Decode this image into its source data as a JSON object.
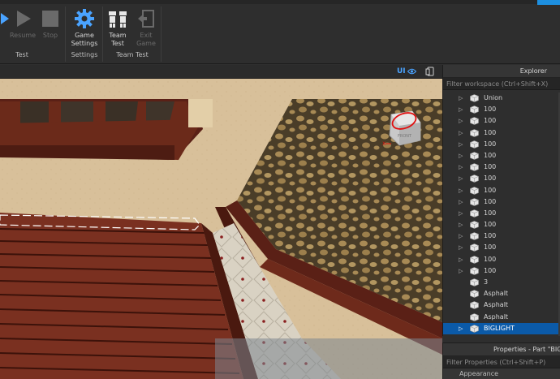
{
  "ribbon": {
    "test_group": {
      "label": "Test",
      "resume": "Resume",
      "stop": "Stop"
    },
    "settings_group": {
      "label": "Settings",
      "game_settings_line1": "Game",
      "game_settings_line2": "Settings"
    },
    "team_test_group": {
      "label": "Team Test",
      "team_test_line1": "Team",
      "team_test_line2": "Test",
      "exit_game_line1": "Exit",
      "exit_game_line2": "Game"
    }
  },
  "viewport_toolbar": {
    "ui_toggle": "UI"
  },
  "explorer": {
    "title": "Explorer",
    "filter_placeholder": "Filter workspace (Ctrl+Shift+X)",
    "items": [
      {
        "label": "Union",
        "expandable": true
      },
      {
        "label": "100",
        "expandable": true
      },
      {
        "label": "100",
        "expandable": true
      },
      {
        "label": "100",
        "expandable": true
      },
      {
        "label": "100",
        "expandable": true
      },
      {
        "label": "100",
        "expandable": true
      },
      {
        "label": "100",
        "expandable": true
      },
      {
        "label": "100",
        "expandable": true
      },
      {
        "label": "100",
        "expandable": true
      },
      {
        "label": "100",
        "expandable": true
      },
      {
        "label": "100",
        "expandable": true
      },
      {
        "label": "100",
        "expandable": true
      },
      {
        "label": "100",
        "expandable": true
      },
      {
        "label": "100",
        "expandable": true
      },
      {
        "label": "100",
        "expandable": true
      },
      {
        "label": "100",
        "expandable": true
      },
      {
        "label": "3",
        "expandable": false
      },
      {
        "label": "Asphalt",
        "expandable": false
      },
      {
        "label": "Asphalt",
        "expandable": false
      },
      {
        "label": "Asphalt",
        "expandable": false
      },
      {
        "label": "BIGLIGHT",
        "expandable": true,
        "selected": true
      }
    ]
  },
  "properties": {
    "title": "Properties - Part \"BIGLIGHT\"",
    "filter_placeholder": "Filter Properties (Ctrl+Shift+P)",
    "first_category": "Appearance"
  },
  "colors": {
    "selection": "#0b5aa8",
    "accent": "#1d8fe0",
    "ui_toggle": "#4aa3ff"
  }
}
